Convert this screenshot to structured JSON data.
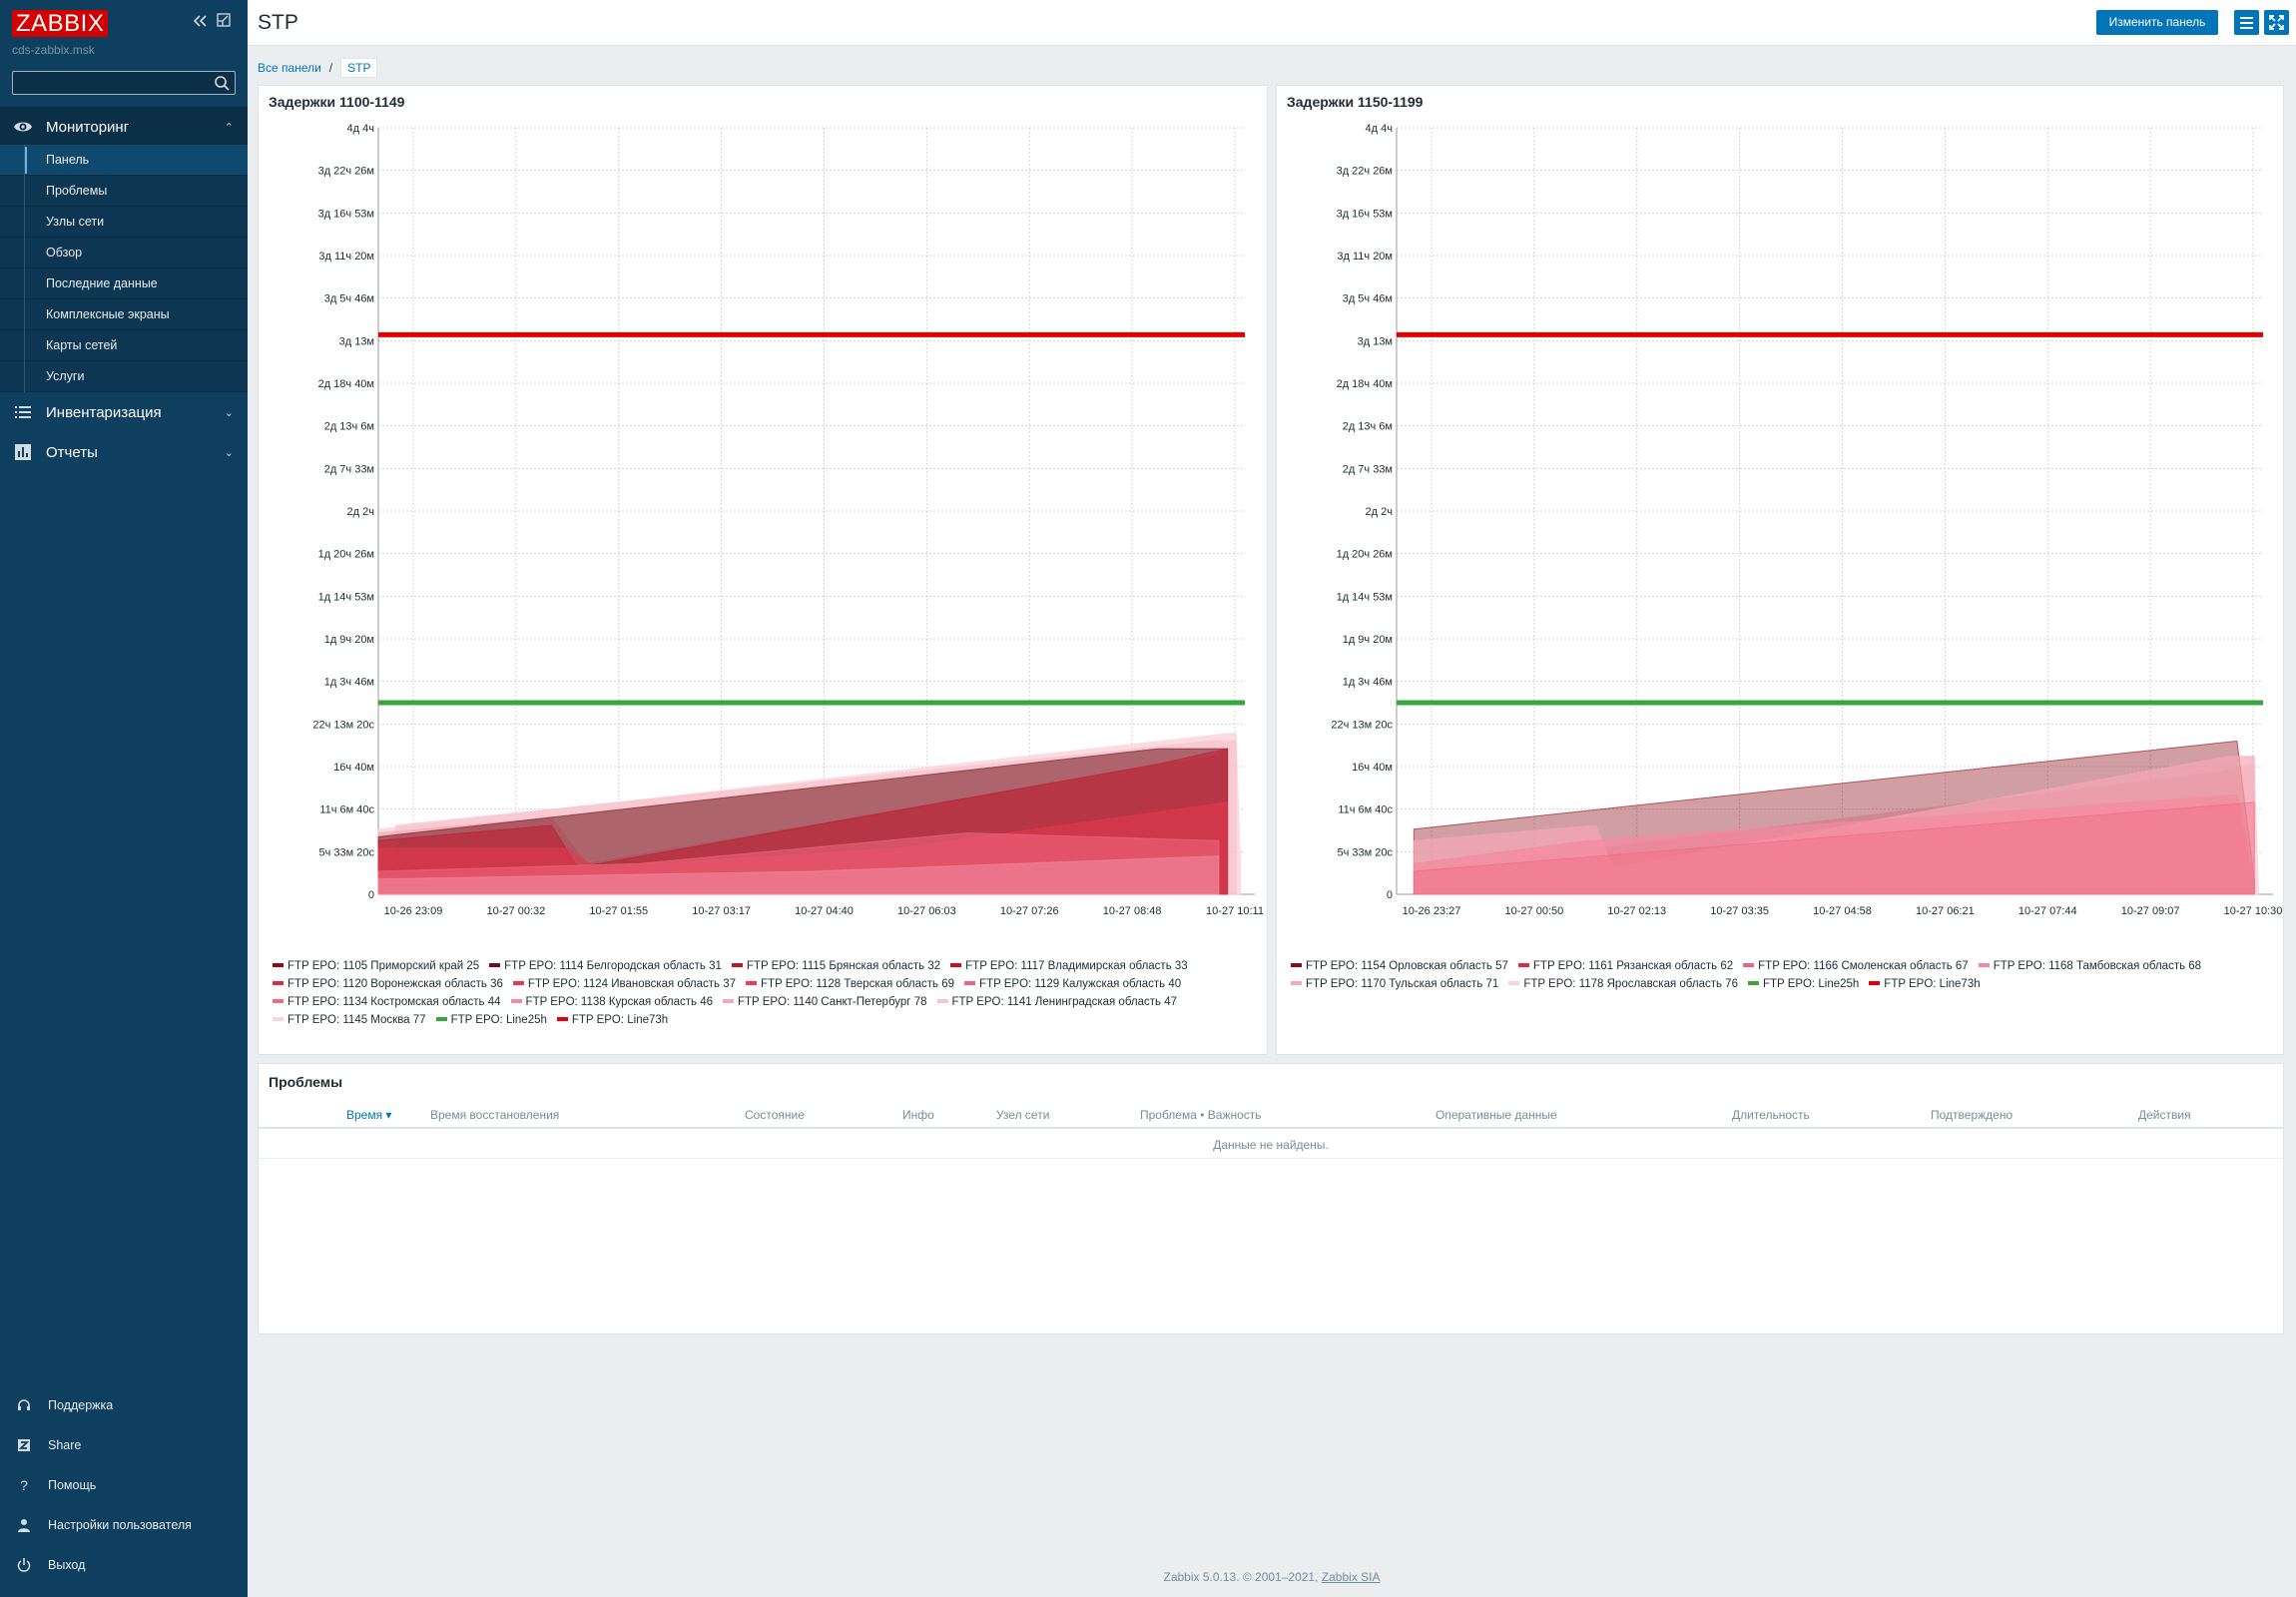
{
  "app": {
    "logo": "ZABBIX",
    "server": "cds-zabbix.msk"
  },
  "sidebar": {
    "sections": [
      {
        "label": "Мониторинг",
        "icon": "eye-icon",
        "expanded": true
      },
      {
        "label": "Инвентаризация",
        "icon": "list-icon",
        "expanded": false
      },
      {
        "label": "Отчеты",
        "icon": "bar-chart-icon",
        "expanded": false
      }
    ],
    "monitoring_items": [
      "Панель",
      "Проблемы",
      "Узлы сети",
      "Обзор",
      "Последние данные",
      "Комплексные экраны",
      "Карты сетей",
      "Услуги"
    ],
    "active_item": "Панель",
    "bottom": [
      {
        "label": "Поддержка",
        "icon": "headset-icon"
      },
      {
        "label": "Share",
        "icon": "share-icon"
      },
      {
        "label": "Помощь",
        "icon": "help-icon"
      },
      {
        "label": "Настройки пользователя",
        "icon": "user-icon"
      },
      {
        "label": "Выход",
        "icon": "power-icon"
      }
    ]
  },
  "header": {
    "title": "STP",
    "edit_label": "Изменить панель"
  },
  "breadcrumb": {
    "all": "Все панели",
    "sep": "/",
    "current": "STP"
  },
  "colors": {
    "line73": "#e40000",
    "line25": "#3aa63a",
    "accent": "#0275b8"
  },
  "graphs": [
    {
      "title": "Задержки 1100-1149",
      "y_ticks": [
        "4д 4ч",
        "3д 22ч 26м",
        "3д 16ч 53м",
        "3д 11ч 20м",
        "3д 5ч 46м",
        "3д 13м",
        "2д 18ч 40м",
        "2д 13ч 6м",
        "2д 7ч 33м",
        "2д 2ч",
        "1д 20ч 26м",
        "1д 14ч 53м",
        "1д 9ч 20м",
        "1д 3ч 46м",
        "22ч 13м 20с",
        "16ч 40м",
        "11ч 6м 40с",
        "5ч 33м 20с",
        "0"
      ],
      "x_ticks": [
        "10-26 23:09",
        "10-27 00:32",
        "10-27 01:55",
        "10-27 03:17",
        "10-27 04:40",
        "10-27 06:03",
        "10-27 07:26",
        "10-27 08:48",
        "10-27 10:11"
      ],
      "legend": [
        {
          "label": "FTP EPO: 1105 Приморский край 25",
          "color": "#8b0d18"
        },
        {
          "label": "FTP EPO: 1114 Белгородская область 31",
          "color": "#6e1018"
        },
        {
          "label": "FTP EPO: 1115 Брянская область 32",
          "color": "#c41428"
        },
        {
          "label": "FTP EPO: 1117 Владимирская область 33",
          "color": "#d10f22"
        },
        {
          "label": "FTP EPO: 1120 Воронежская область 36",
          "color": "#e0284a"
        },
        {
          "label": "FTP EPO: 1124 Ивановская область 37",
          "color": "#e8384f"
        },
        {
          "label": "FTP EPO: 1128 Тверская область 69",
          "color": "#ee3a56"
        },
        {
          "label": "FTP EPO: 1129 Калужская область 40",
          "color": "#f0647e"
        },
        {
          "label": "FTP EPO: 1134 Костромская область 44",
          "color": "#f16c84"
        },
        {
          "label": "FTP EPO: 1138 Курская область 46",
          "color": "#f48aa0"
        },
        {
          "label": "FTP EPO: 1140 Санкт-Петербург 78",
          "color": "#f5a8b5"
        },
        {
          "label": "FTP EPO: 1141 Ленинградская область 47",
          "color": "#f9c2cc"
        },
        {
          "label": "FTP EPO: 1145 Москва 77",
          "color": "#fbd3da"
        },
        {
          "label": "FTP EPO: Line25h",
          "color": "#3aa63a"
        },
        {
          "label": "FTP EPO: Line73h",
          "color": "#e40000"
        }
      ]
    },
    {
      "title": "Задержки 1150-1199",
      "y_ticks": [
        "4д 4ч",
        "3д 22ч 26м",
        "3д 16ч 53м",
        "3д 11ч 20м",
        "3д 5ч 46м",
        "3д 13м",
        "2д 18ч 40м",
        "2д 13ч 6м",
        "2д 7ч 33м",
        "2д 2ч",
        "1д 20ч 26м",
        "1д 14ч 53м",
        "1д 9ч 20м",
        "1д 3ч 46м",
        "22ч 13м 20с",
        "16ч 40м",
        "11ч 6м 40с",
        "5ч 33м 20с",
        "0"
      ],
      "x_ticks": [
        "10-26 23:27",
        "10-27 00:50",
        "10-27 02:13",
        "10-27 03:35",
        "10-27 04:58",
        "10-27 06:21",
        "10-27 07:44",
        "10-27 09:07",
        "10-27 10:30"
      ],
      "legend": [
        {
          "label": "FTP EPO: 1154 Орловская область 57",
          "color": "#8b0d18"
        },
        {
          "label": "FTP EPO: 1161 Рязанская область 62",
          "color": "#e0284a"
        },
        {
          "label": "FTP EPO: 1166 Смоленская область 67",
          "color": "#f0647e"
        },
        {
          "label": "FTP EPO: 1168 Тамбовская область 68",
          "color": "#f48aa0"
        },
        {
          "label": "FTP EPO: 1170 Тульская область 71",
          "color": "#f5a8b5"
        },
        {
          "label": "FTP EPO: 1178 Ярославская область 76",
          "color": "#fbd3da"
        },
        {
          "label": "FTP EPO: Line25h",
          "color": "#3aa63a"
        },
        {
          "label": "FTP EPO: Line73h",
          "color": "#e40000"
        }
      ]
    }
  ],
  "problems": {
    "title": "Проблемы",
    "columns": [
      "Время ▾",
      "Время восстановления",
      "Состояние",
      "Инфо",
      "Узел сети",
      "Проблема • Важность",
      "Оперативные данные",
      "Длительность",
      "Подтверждено",
      "Действия"
    ],
    "empty": "Данные не найдены."
  },
  "footer": {
    "text": "Zabbix 5.0.13. © 2001–2021,",
    "link": "Zabbix SIA"
  }
}
